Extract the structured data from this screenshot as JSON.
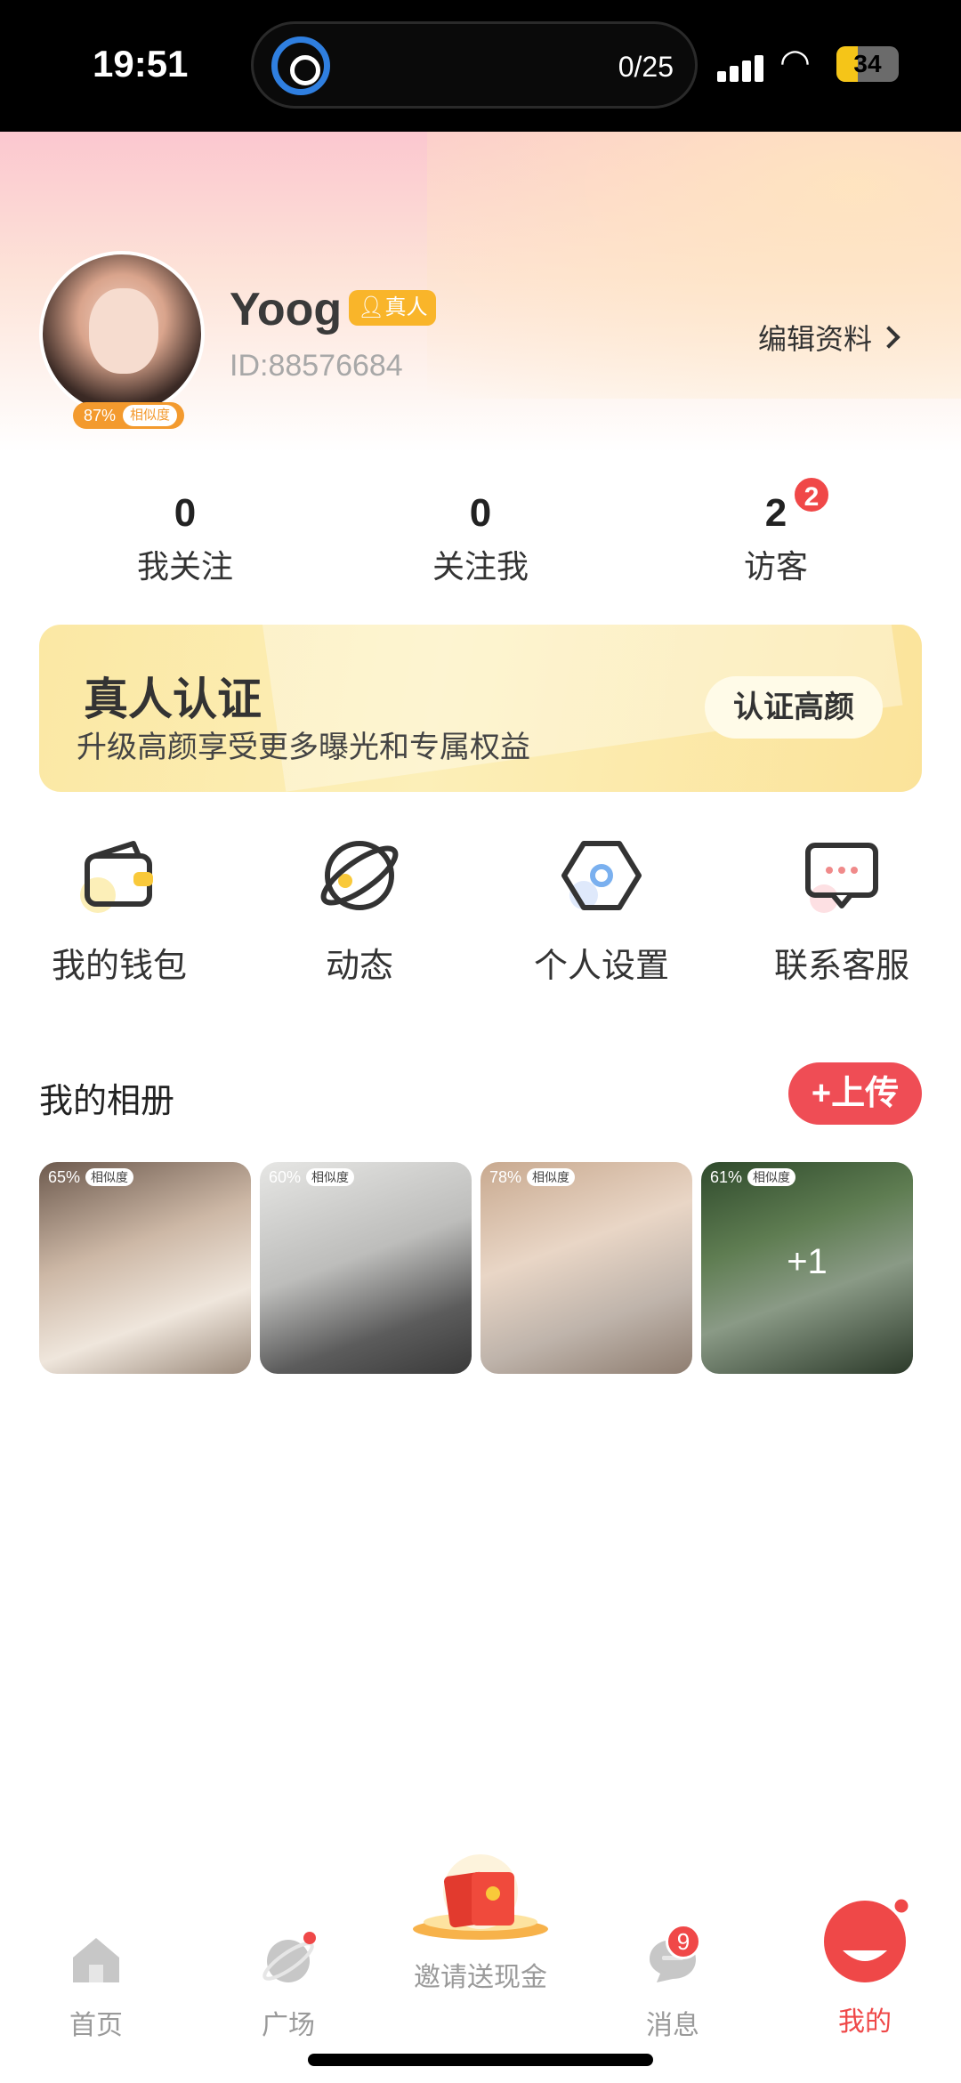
{
  "status_bar": {
    "time": "19:51",
    "upload_counter": "0/25",
    "battery": "34",
    "battery_level": 0.34
  },
  "profile": {
    "username": "Yoog",
    "verified_badge": "真人",
    "user_id": "ID:88576684",
    "similarity_percent": "87%",
    "similarity_label": "相似度",
    "edit_label": "编辑资料"
  },
  "stats": [
    {
      "value": "0",
      "label": "我关注"
    },
    {
      "value": "0",
      "label": "关注我"
    },
    {
      "value": "2",
      "label": "访客",
      "badge": "2"
    }
  ],
  "verify_banner": {
    "title": "真人认证",
    "subtitle": "升级高颜享受更多曝光和专属权益",
    "button": "认证高颜"
  },
  "actions": [
    {
      "label": "我的钱包",
      "icon": "wallet-icon"
    },
    {
      "label": "动态",
      "icon": "planet-icon"
    },
    {
      "label": "个人设置",
      "icon": "settings-hexagon-icon"
    },
    {
      "label": "联系客服",
      "icon": "chat-bubble-icon"
    }
  ],
  "album": {
    "title": "我的相册",
    "upload_button": "+上传",
    "similarity_label": "相似度",
    "photos": [
      {
        "similarity": "65%"
      },
      {
        "similarity": "60%"
      },
      {
        "similarity": "78%"
      },
      {
        "similarity": "61%",
        "more": "+1"
      }
    ]
  },
  "tabbar": {
    "tabs": [
      {
        "label": "首页",
        "icon": "home-icon"
      },
      {
        "label": "广场",
        "icon": "planet-icon"
      },
      {
        "label": "邀请送现金",
        "icon": "red-envelope-icon"
      },
      {
        "label": "消息",
        "icon": "message-icon",
        "badge": "9"
      },
      {
        "label": "我的",
        "icon": "smile-face-icon"
      }
    ]
  },
  "colors": {
    "accent_red": "#ef4848",
    "badge_orange": "#f9b52a",
    "banner_yellow": "#fbe8a4"
  }
}
